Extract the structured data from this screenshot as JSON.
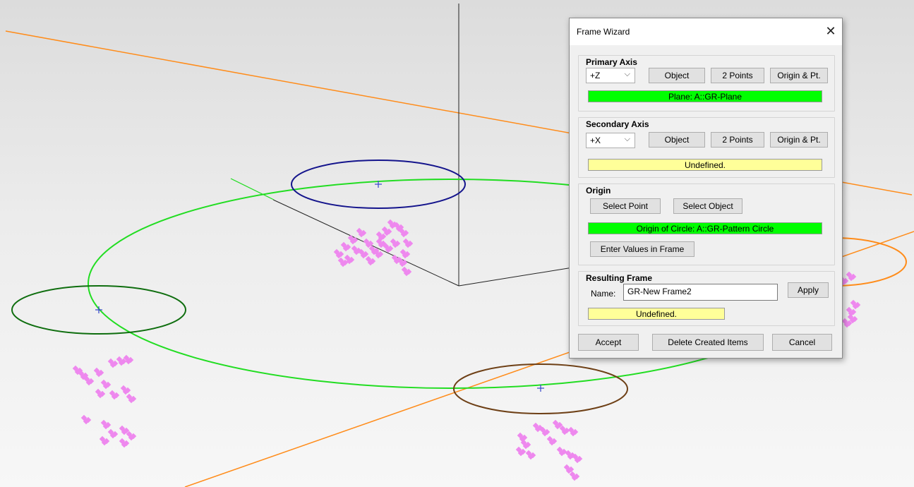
{
  "dialog": {
    "title": "Frame Wizard",
    "close_glyph": "✕",
    "primary_axis": {
      "label": "Primary Axis",
      "direction": "+Z",
      "object_btn": "Object",
      "two_points_btn": "2 Points",
      "origin_pt_btn": "Origin & Pt.",
      "status": "Plane: A::GR-Plane"
    },
    "secondary_axis": {
      "label": "Secondary Axis",
      "direction": "+X",
      "object_btn": "Object",
      "two_points_btn": "2 Points",
      "origin_pt_btn": "Origin & Pt.",
      "status": "Undefined."
    },
    "origin": {
      "label": "Origin",
      "select_point_btn": "Select Point",
      "select_object_btn": "Select Object",
      "status": "Origin of Circle: A::GR-Pattern Circle",
      "enter_values_btn": "Enter Values in Frame"
    },
    "resulting_frame": {
      "label": "Resulting Frame",
      "name_label": "Name:",
      "name_value": "GR-New Frame2",
      "apply_btn": "Apply",
      "status": "Undefined."
    },
    "footer": {
      "accept_btn": "Accept",
      "delete_btn": "Delete Created Items",
      "cancel_btn": "Cancel"
    }
  },
  "colors": {
    "status_ok": "#00ff00",
    "status_undefined": "#ffff99",
    "curve_green": "#22dd22",
    "orange_line": "#ff8c1a",
    "marker_pink": "#ee88ee"
  }
}
